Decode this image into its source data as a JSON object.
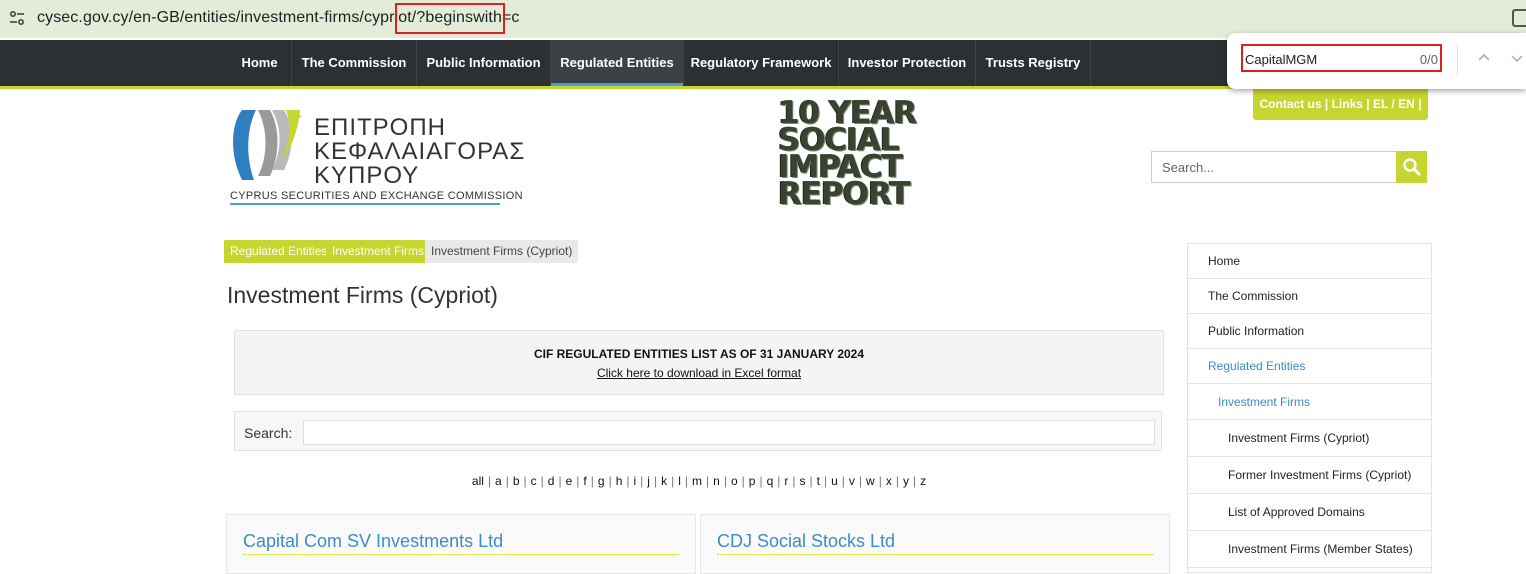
{
  "browser": {
    "url": "cysec.gov.cy/en-GB/entities/investment-firms/cypriot/?beginswith=c",
    "icons": [
      "site-info-icon",
      "extension-icon"
    ]
  },
  "find_bar": {
    "query": "CapitalMGM",
    "count": "0/0",
    "icons": [
      "chevron-up-icon",
      "chevron-down-icon"
    ]
  },
  "nav": {
    "items": [
      {
        "label": "Home",
        "active": false
      },
      {
        "label": "The Commission",
        "active": false
      },
      {
        "label": "Public Information",
        "active": false
      },
      {
        "label": "Regulated Entities",
        "active": true
      },
      {
        "label": "Regulatory Framework",
        "active": false
      },
      {
        "label": "Investor Protection",
        "active": false
      },
      {
        "label": "Trusts Registry",
        "active": false
      }
    ]
  },
  "header": {
    "logo_line1": "ΕΠΙΤΡΟΠΗ",
    "logo_line2": "ΚΕΦΑΛΑΙΑΓΟΡΑΣ",
    "logo_line3": "ΚΥΠΡΟΥ",
    "logo_sub": "CYPRUS SECURITIES AND EXCHANGE COMMISSION",
    "report_lines": [
      "10 YEAR",
      "SOCIAL",
      "IMPACT",
      "REPORT"
    ],
    "contact_us": "Contact us",
    "links": "Links",
    "lang": "EL / EN",
    "search_placeholder": "Search..."
  },
  "breadcrumb": [
    "Regulated Entities",
    "Investment Firms",
    "Investment Firms (Cypriot)"
  ],
  "page_title": "Investment Firms (Cypriot)",
  "notice": {
    "title": "CIF REGULATED ENTITIES LIST AS OF 31 JANUARY 2024",
    "link": "Click here to download in Excel format"
  },
  "search": {
    "label": "Search:"
  },
  "alphabet": [
    "all",
    "a",
    "b",
    "c",
    "d",
    "e",
    "f",
    "g",
    "h",
    "i",
    "j",
    "k",
    "l",
    "m",
    "n",
    "o",
    "p",
    "q",
    "r",
    "s",
    "t",
    "u",
    "v",
    "w",
    "x",
    "y",
    "z"
  ],
  "cards": [
    {
      "title": "Capital Com SV Investments Ltd"
    },
    {
      "title": "CDJ Social Stocks Ltd"
    }
  ],
  "sidebar": {
    "items": [
      {
        "label": "Home",
        "level": 0
      },
      {
        "label": "The Commission",
        "level": 0
      },
      {
        "label": "Public Information",
        "level": 0
      },
      {
        "label": "Regulated Entities",
        "level": 0
      },
      {
        "label": "Investment Firms",
        "level": 1
      },
      {
        "label": "Investment Firms (Cypriot)",
        "level": 2
      },
      {
        "label": "Former Investment Firms (Cypriot)",
        "level": 2
      },
      {
        "label": "List of Approved Domains",
        "level": 2
      },
      {
        "label": "Investment Firms (Member States)",
        "level": 2
      }
    ]
  },
  "colors": {
    "accent_green": "#c6d530",
    "nav_bg": "#2c2f33",
    "link_blue": "#3d8cc4",
    "highlight_red": "#e02020"
  }
}
